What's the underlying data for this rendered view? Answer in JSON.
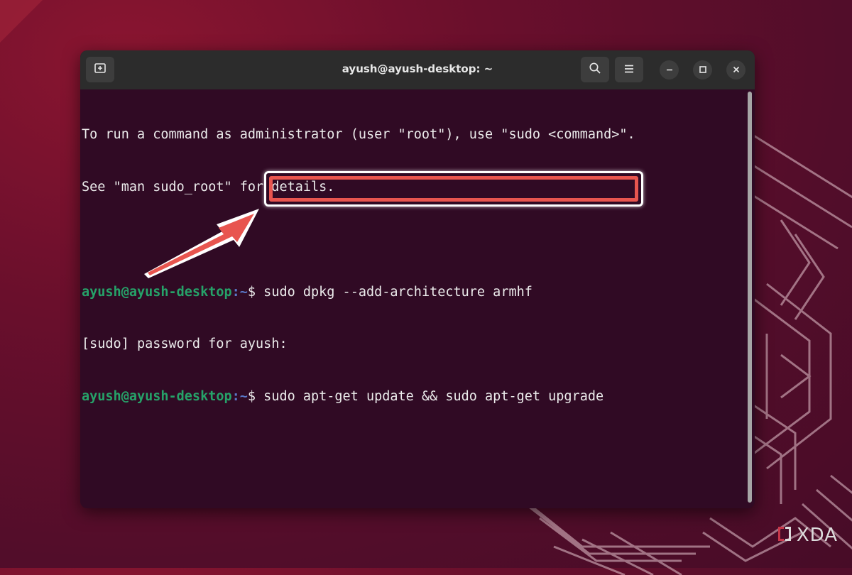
{
  "window": {
    "title": "ayush@ayush-desktop: ~"
  },
  "toolbar_icons": {
    "new_tab": "new-tab-icon",
    "search": "search-icon",
    "menu": "hamburger-menu-icon",
    "minimize": "minimize-icon",
    "maximize": "maximize-icon",
    "close": "close-icon"
  },
  "terminal": {
    "lines": [
      {
        "text": "To run a command as administrator (user \"root\"), use \"sudo <command>\"."
      },
      {
        "text": "See \"man sudo_root\" for details."
      },
      {
        "text": ""
      },
      {
        "prompt_user": "ayush@ayush-desktop",
        "prompt_path": ":~",
        "command": "$ sudo dpkg --add-architecture armhf"
      },
      {
        "text": "[sudo] password for ayush:"
      },
      {
        "prompt_user": "ayush@ayush-desktop",
        "prompt_path": ":~",
        "command": "$ sudo apt-get update && sudo apt-get upgrade"
      }
    ]
  },
  "annotation": {
    "highlight_color": "#e8554f"
  },
  "watermark": {
    "text": "XDA"
  },
  "colors": {
    "prompt_user": "#26a269",
    "prompt_path": "#5a78c8",
    "terminal_bg": "#300a24",
    "titlebar_bg": "#2c2c2c"
  }
}
